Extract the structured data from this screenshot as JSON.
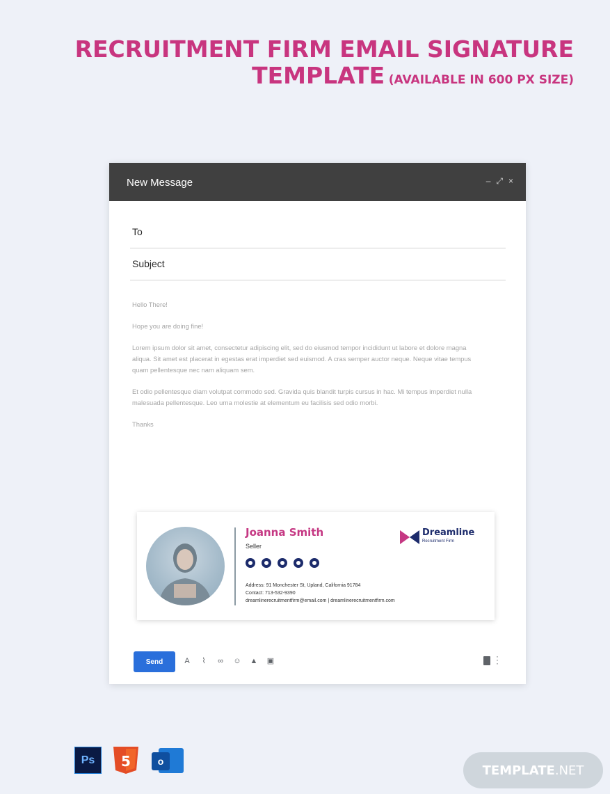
{
  "page": {
    "title_line1": "RECRUITMENT FIRM EMAIL SIGNATURE",
    "title_line2": "TEMPLATE",
    "title_note": "(AVAILABLE IN 600 PX SIZE)",
    "accent_color": "#c8357f"
  },
  "window": {
    "title": "New Message",
    "controls": [
      "–",
      "⤢",
      "×"
    ]
  },
  "fields": {
    "to_label": "To",
    "subject_label": "Subject"
  },
  "body": {
    "greeting": "Hello There!",
    "line2": "Hope you are doing fine!",
    "para1": "Lorem ipsum dolor sit amet, consectetur adipiscing elit, sed do eiusmod tempor incididunt ut labore et dolore magna aliqua. Sit amet est placerat in egestas erat imperdiet sed euismod. A cras semper auctor neque. Neque vitae tempus quam pellentesque nec nam aliquam sem.",
    "para2": "Et odio pellentesque diam volutpat commodo sed. Gravida quis blandit turpis cursus in hac. Mi tempus imperdiet nulla malesuada pellentesque. Leo urna molestie at elementum eu facilisis sed odio morbi.",
    "closing": "Thanks"
  },
  "signature": {
    "name": "Joanna Smith",
    "role": "Seller",
    "social_icons": [
      "facebook-icon",
      "twitter-icon",
      "linkedin-icon",
      "instagram-icon",
      "pinterest-icon"
    ],
    "address": "Address: 91 Monchester St, Upland, California 91784",
    "contact": "Contact: 713-532-9390",
    "email_web": "dreamlinerecruitmentfirm@email.com | dreamlinerecruitmentfirm.com",
    "brand": "Dreamline",
    "brand_sub": "Recruitment Firm",
    "name_color": "#c53883",
    "brand_color": "#1c2b6b"
  },
  "toolbar": {
    "send_label": "Send",
    "tools": [
      "format-text-icon",
      "attach-icon",
      "link-icon",
      "emoji-icon",
      "drive-icon",
      "photo-icon"
    ]
  },
  "footer": {
    "ps_label": "Ps",
    "html5_label": "5",
    "outlook_label": "o",
    "badge_main": "TEMPLATE",
    "badge_suffix": ".NET"
  }
}
